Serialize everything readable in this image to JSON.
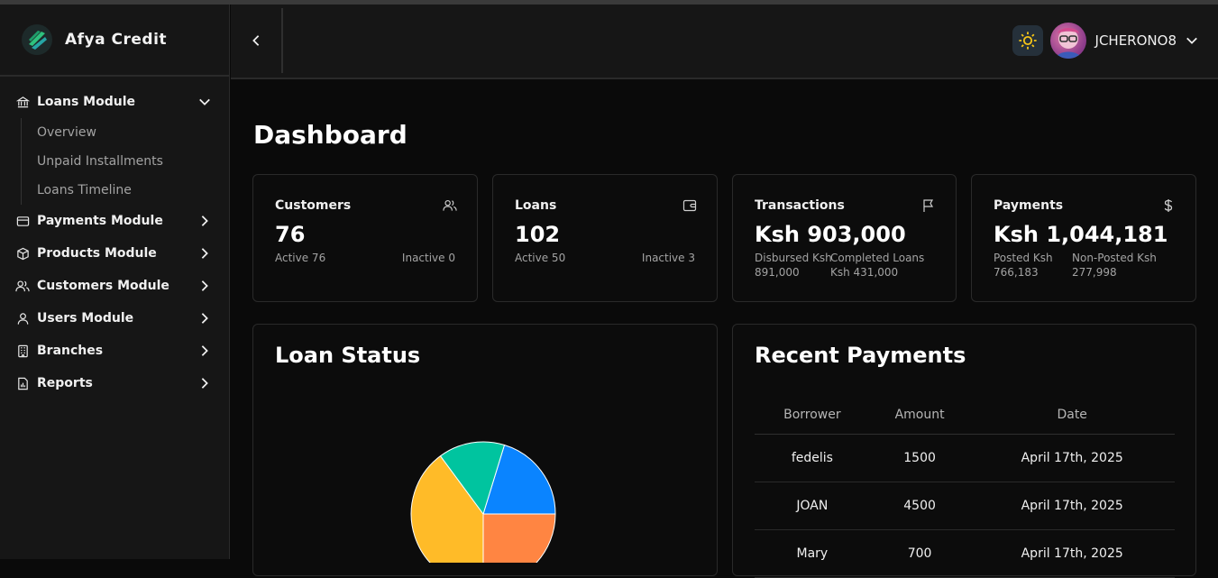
{
  "brand": {
    "name": "Afya Credit"
  },
  "sidebar": {
    "loans": {
      "label": "Loans Module",
      "sub": [
        "Overview",
        "Unpaid Installments",
        "Loans Timeline"
      ]
    },
    "items": [
      {
        "label": "Payments Module",
        "icon": "credit-card-icon"
      },
      {
        "label": "Products Module",
        "icon": "package-icon"
      },
      {
        "label": "Customers Module",
        "icon": "users-icon"
      },
      {
        "label": "Users Module",
        "icon": "user-icon"
      },
      {
        "label": "Branches",
        "icon": "building-icon"
      },
      {
        "label": "Reports",
        "icon": "report-icon"
      }
    ]
  },
  "header": {
    "username": "JCHERONO8"
  },
  "page": {
    "title": "Dashboard"
  },
  "stats": {
    "customers": {
      "title": "Customers",
      "value": "76",
      "left": "Active 76",
      "right": "Inactive 0"
    },
    "loans": {
      "title": "Loans",
      "value": "102",
      "left": "Active 50",
      "right": "Inactive 3"
    },
    "transactions": {
      "title": "Transactions",
      "value": "Ksh 903,000",
      "left_label": "Disbursed Ksh",
      "left_value": "891,000",
      "right_label": "Completed Loans",
      "right_value": "Ksh 431,000"
    },
    "payments": {
      "title": "Payments",
      "value": "Ksh 1,044,181",
      "left_label": "Posted Ksh",
      "left_value": "766,183",
      "right_label": "Non-Posted Ksh",
      "right_value": "277,998"
    }
  },
  "loan_status": {
    "title": "Loan Status"
  },
  "recent_payments": {
    "title": "Recent Payments",
    "columns": [
      "Borrower",
      "Amount",
      "Date"
    ],
    "rows": [
      [
        "fedelis",
        "1500",
        "April 17th, 2025"
      ],
      [
        "JOAN",
        "4500",
        "April 17th, 2025"
      ],
      [
        "Mary",
        "700",
        "April 17th, 2025"
      ]
    ]
  },
  "colors": {
    "blue": "#0a84ff",
    "orange": "#ff8542",
    "yellow": "#ffbb28",
    "teal": "#00c49f",
    "sun": "#f5c518"
  }
}
